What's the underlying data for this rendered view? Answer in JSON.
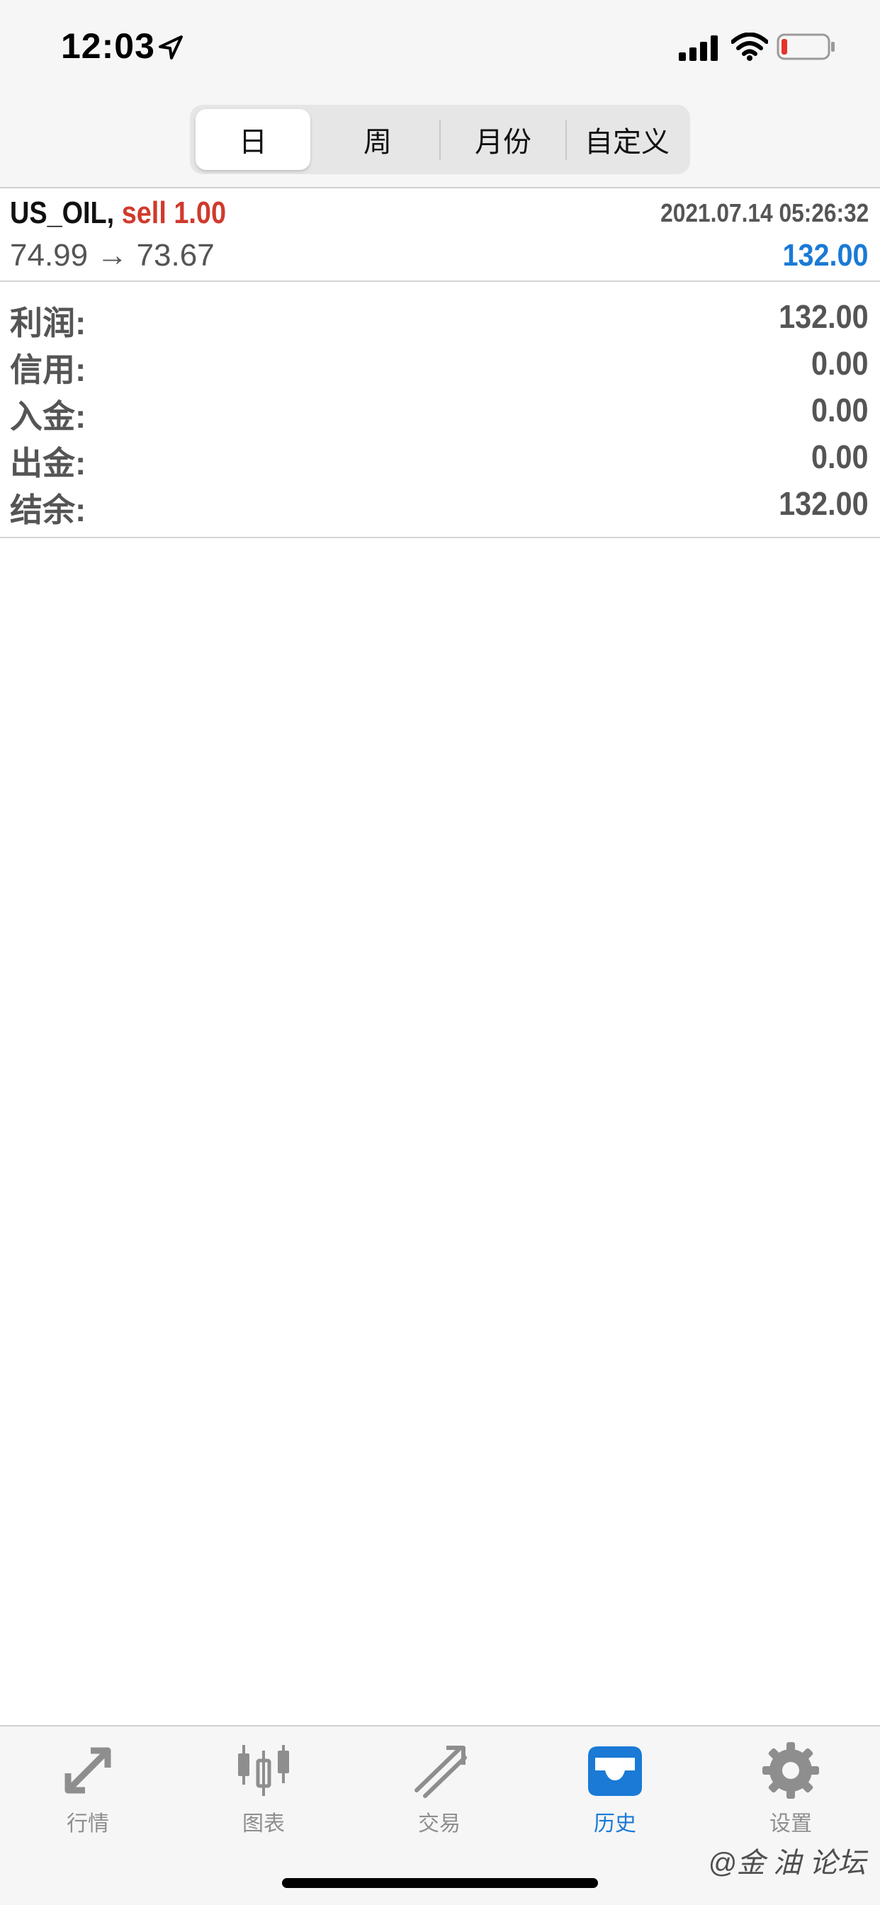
{
  "status_bar": {
    "time": "12:03"
  },
  "segments": [
    {
      "label": "日",
      "active": true
    },
    {
      "label": "周",
      "active": false
    },
    {
      "label": "月份",
      "active": false
    },
    {
      "label": "自定义",
      "active": false
    }
  ],
  "trade": {
    "symbol": "US_OIL,",
    "side": "sell 1.00",
    "datetime": "2021.07.14 05:26:32",
    "prices": "74.99 → 73.67",
    "profit": "132.00"
  },
  "summary": [
    {
      "label": "利润:",
      "value": "132.00"
    },
    {
      "label": "信用:",
      "value": "0.00"
    },
    {
      "label": "入金:",
      "value": "0.00"
    },
    {
      "label": "出金:",
      "value": "0.00"
    },
    {
      "label": "结余:",
      "value": "132.00"
    }
  ],
  "tabs": [
    {
      "label": "行情",
      "icon": "quotes-icon",
      "active": false
    },
    {
      "label": "图表",
      "icon": "chart-icon",
      "active": false
    },
    {
      "label": "交易",
      "icon": "trade-icon",
      "active": false
    },
    {
      "label": "历史",
      "icon": "history-icon",
      "active": true
    },
    {
      "label": "设置",
      "icon": "settings-icon",
      "active": false
    }
  ],
  "watermark": "@金 油 论坛",
  "colors": {
    "accent": "#1a7ad6",
    "sell": "#d03a2c",
    "inactive": "#8e8e8e"
  }
}
